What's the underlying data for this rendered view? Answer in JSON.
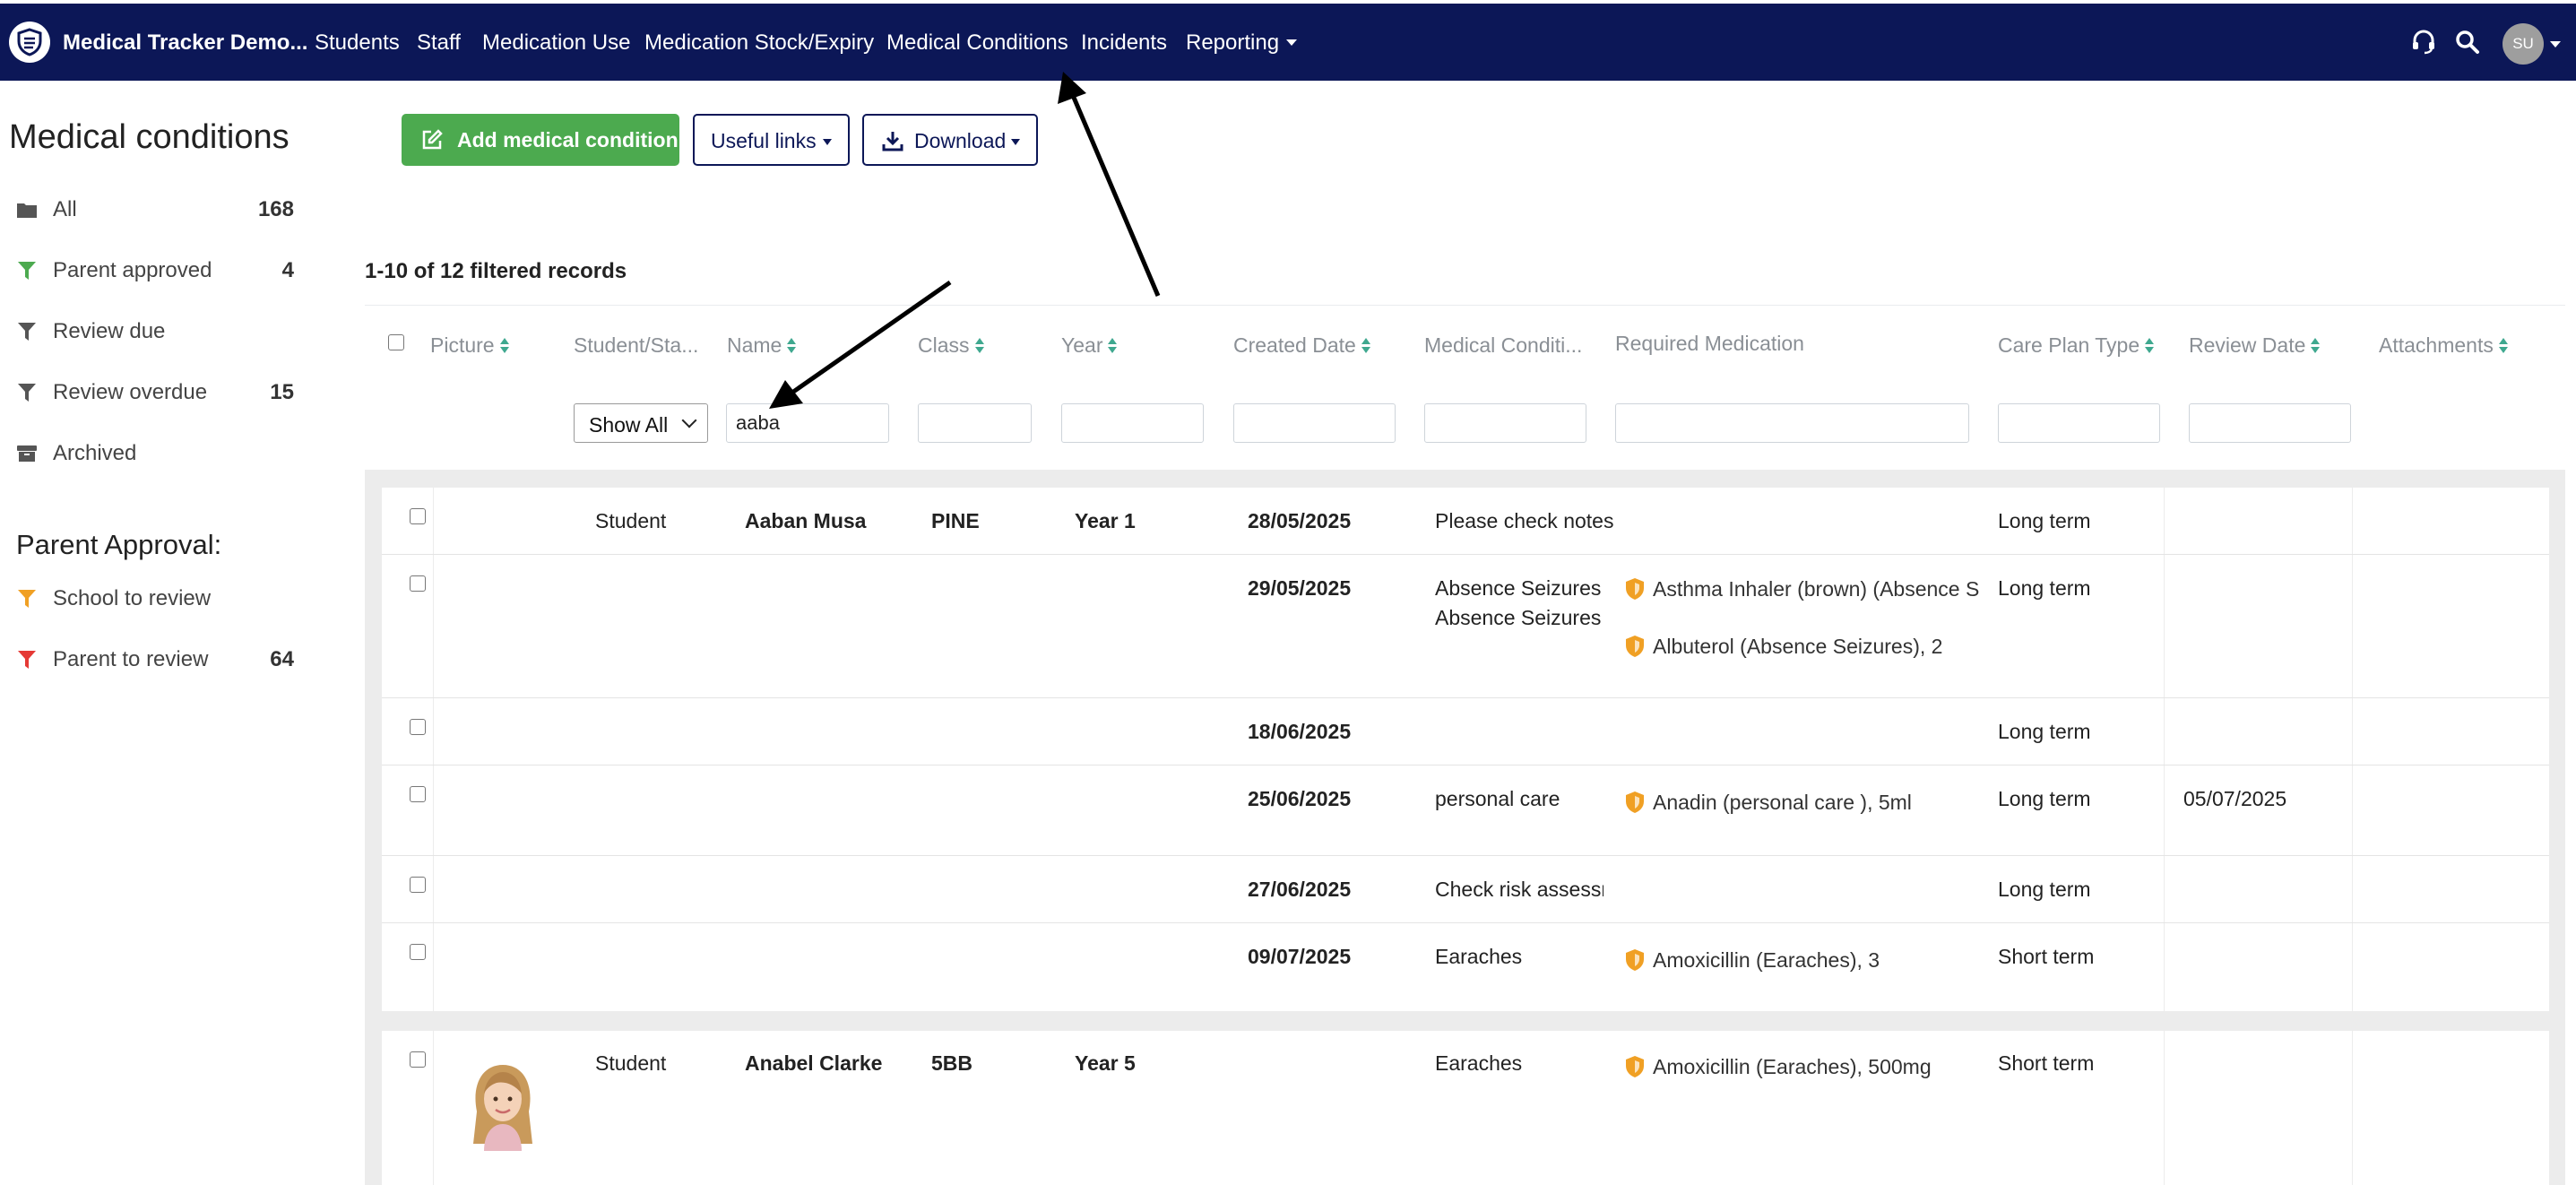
{
  "nav": {
    "brand": "Medical Tracker Demo...",
    "items": [
      "Students",
      "Staff",
      "Medication Use",
      "Medication Stock/Expiry",
      "Medical Conditions",
      "Incidents",
      "Reporting"
    ],
    "avatar_initials": "SU"
  },
  "sidebar": {
    "title": "Medical conditions",
    "items": [
      {
        "label": "All",
        "count": "168",
        "icon": "folder-icon",
        "color": "#555555"
      },
      {
        "label": "Parent approved",
        "count": "4",
        "icon": "filter-icon",
        "color": "#4caa4f"
      },
      {
        "label": "Review due",
        "count": "",
        "icon": "filter-icon",
        "color": "#555555"
      },
      {
        "label": "Review overdue",
        "count": "15",
        "icon": "filter-icon",
        "color": "#555555"
      },
      {
        "label": "Archived",
        "count": "",
        "icon": "archive-icon",
        "color": "#555555"
      }
    ],
    "parent_approval_title": "Parent Approval:",
    "parent_items": [
      {
        "label": "School to review",
        "count": "",
        "icon": "filter-icon",
        "color": "#f0a024"
      },
      {
        "label": "Parent to review",
        "count": "64",
        "icon": "filter-icon",
        "color": "#e53935"
      }
    ]
  },
  "toolbar": {
    "add_label": "Add medical condition",
    "useful_links_label": "Useful links",
    "download_label": "Download"
  },
  "records_text": "1-10 of 12 filtered records",
  "table": {
    "headers": [
      "Picture",
      "Student/Sta...",
      "Name",
      "Class",
      "Year",
      "Created Date",
      "Medical Conditi...",
      "Required Medication",
      "Care Plan Type",
      "Review Date",
      "Attachments"
    ],
    "filters": {
      "type_selected": "Show All",
      "name_value": "aaba"
    },
    "groups": [
      {
        "rows": [
          {
            "type": "Student",
            "name": "Aaban Musa",
            "class": "PINE",
            "year": "Year 1",
            "created": "28/05/2025",
            "conditions": [
              "Please check notes"
            ],
            "medications": [],
            "care_plan": "Long term",
            "review": ""
          },
          {
            "type": "",
            "name": "",
            "class": "",
            "year": "",
            "created": "29/05/2025",
            "conditions": [
              "Absence Seizures",
              "Absence Seizures"
            ],
            "medications": [
              "Asthma Inhaler (brown) (Absence Sei",
              "Albuterol (Absence Seizures), 2"
            ],
            "care_plan": "Long term",
            "review": ""
          },
          {
            "type": "",
            "name": "",
            "class": "",
            "year": "",
            "created": "18/06/2025",
            "conditions": [],
            "medications": [],
            "care_plan": "Long term",
            "review": ""
          },
          {
            "type": "",
            "name": "",
            "class": "",
            "year": "",
            "created": "25/06/2025",
            "conditions": [
              "personal care"
            ],
            "medications": [
              "Anadin (personal care ), 5ml"
            ],
            "care_plan": "Long term",
            "review": "05/07/2025"
          },
          {
            "type": "",
            "name": "",
            "class": "",
            "year": "",
            "created": "27/06/2025",
            "conditions": [
              "Check risk assessn"
            ],
            "medications": [],
            "care_plan": "Long term",
            "review": ""
          },
          {
            "type": "",
            "name": "",
            "class": "",
            "year": "",
            "created": "09/07/2025",
            "conditions": [
              "Earaches"
            ],
            "medications": [
              "Amoxicillin (Earaches), 3"
            ],
            "care_plan": "Short term",
            "review": ""
          }
        ]
      },
      {
        "rows": [
          {
            "type": "Student",
            "name": "Anabel Clarke",
            "class": "5BB",
            "year": "Year 5",
            "created": "",
            "conditions": [
              "Earaches"
            ],
            "medications": [
              "Amoxicillin (Earaches), 500mg"
            ],
            "care_plan": "Short term",
            "review": ""
          }
        ]
      }
    ]
  },
  "colors": {
    "nav_bg": "#0c1757",
    "add_button": "#4caa4f",
    "sort_arrow": "#3fa88f",
    "medication_shield": "#f0a024"
  }
}
